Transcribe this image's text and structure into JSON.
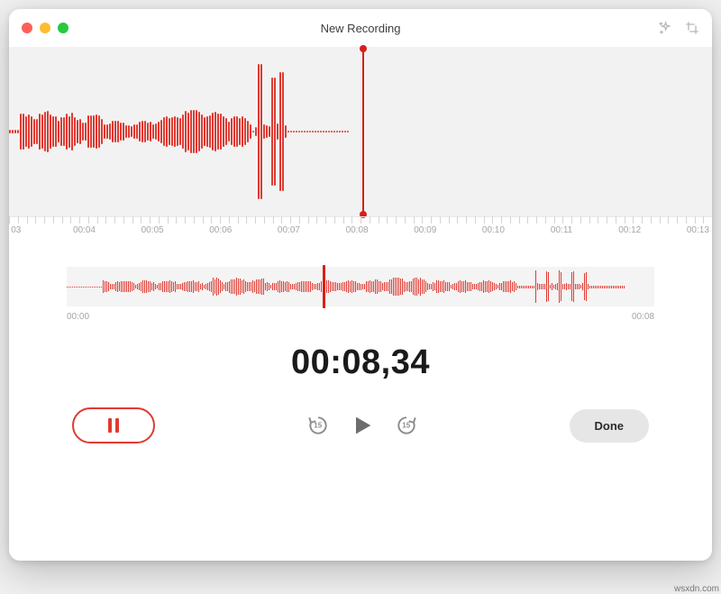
{
  "window": {
    "title": "New Recording"
  },
  "ruler": {
    "labels": [
      "03",
      "00:04",
      "00:05",
      "00:06",
      "00:07",
      "00:08",
      "00:09",
      "00:10",
      "00:11",
      "00:12",
      "00:13"
    ],
    "positions_pct": [
      1,
      10.7,
      20.4,
      30.1,
      39.8,
      49.5,
      59.2,
      68.9,
      78.6,
      88.3,
      98.0
    ]
  },
  "mini": {
    "start_label": "00:00",
    "end_label": "00:08"
  },
  "timer": {
    "display": "00:08,34"
  },
  "controls": {
    "skip_amount": "15",
    "done_label": "Done"
  },
  "colors": {
    "accent": "#e03a32"
  },
  "credit": "wsxdn.com"
}
